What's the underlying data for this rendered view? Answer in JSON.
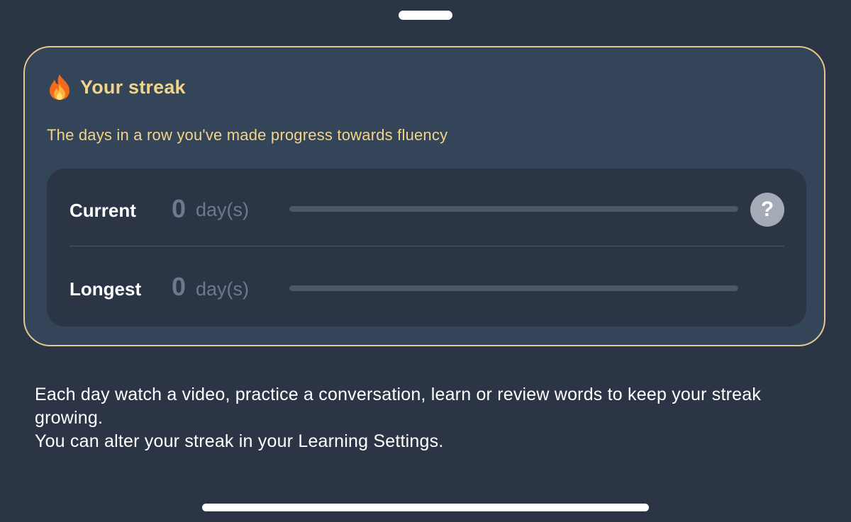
{
  "streak_card": {
    "icon": "fire-icon",
    "title": "Your streak",
    "subtitle": "The days in a row you've made progress towards fluency"
  },
  "stats": {
    "current": {
      "label": "Current",
      "value": "0",
      "unit": "day(s)",
      "progress": 0
    },
    "longest": {
      "label": "Longest",
      "value": "0",
      "unit": "day(s)",
      "progress": 0
    },
    "help_label": "?"
  },
  "info": {
    "line1": "Each day watch a video, practice a conversation, learn or review words to keep your streak growing.",
    "line2": "You can alter your streak in your Learning Settings."
  },
  "colors": {
    "accent": "#f2d488",
    "card_border": "#e3c98a",
    "card_background": "#344459",
    "background": "#2b3546",
    "muted_text": "#6d7a8b"
  }
}
